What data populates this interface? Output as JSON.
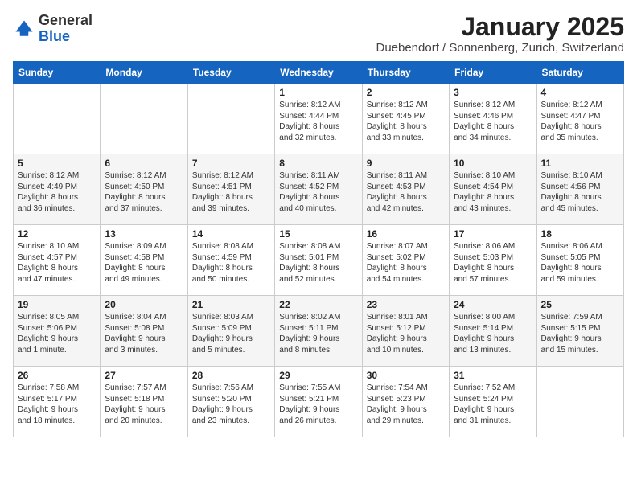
{
  "logo": {
    "general": "General",
    "blue": "Blue"
  },
  "title": "January 2025",
  "subtitle": "Duebendorf / Sonnenberg, Zurich, Switzerland",
  "weekdays": [
    "Sunday",
    "Monday",
    "Tuesday",
    "Wednesday",
    "Thursday",
    "Friday",
    "Saturday"
  ],
  "weeks": [
    [
      {
        "day": "",
        "info": ""
      },
      {
        "day": "",
        "info": ""
      },
      {
        "day": "",
        "info": ""
      },
      {
        "day": "1",
        "info": "Sunrise: 8:12 AM\nSunset: 4:44 PM\nDaylight: 8 hours\nand 32 minutes."
      },
      {
        "day": "2",
        "info": "Sunrise: 8:12 AM\nSunset: 4:45 PM\nDaylight: 8 hours\nand 33 minutes."
      },
      {
        "day": "3",
        "info": "Sunrise: 8:12 AM\nSunset: 4:46 PM\nDaylight: 8 hours\nand 34 minutes."
      },
      {
        "day": "4",
        "info": "Sunrise: 8:12 AM\nSunset: 4:47 PM\nDaylight: 8 hours\nand 35 minutes."
      }
    ],
    [
      {
        "day": "5",
        "info": "Sunrise: 8:12 AM\nSunset: 4:49 PM\nDaylight: 8 hours\nand 36 minutes."
      },
      {
        "day": "6",
        "info": "Sunrise: 8:12 AM\nSunset: 4:50 PM\nDaylight: 8 hours\nand 37 minutes."
      },
      {
        "day": "7",
        "info": "Sunrise: 8:12 AM\nSunset: 4:51 PM\nDaylight: 8 hours\nand 39 minutes."
      },
      {
        "day": "8",
        "info": "Sunrise: 8:11 AM\nSunset: 4:52 PM\nDaylight: 8 hours\nand 40 minutes."
      },
      {
        "day": "9",
        "info": "Sunrise: 8:11 AM\nSunset: 4:53 PM\nDaylight: 8 hours\nand 42 minutes."
      },
      {
        "day": "10",
        "info": "Sunrise: 8:10 AM\nSunset: 4:54 PM\nDaylight: 8 hours\nand 43 minutes."
      },
      {
        "day": "11",
        "info": "Sunrise: 8:10 AM\nSunset: 4:56 PM\nDaylight: 8 hours\nand 45 minutes."
      }
    ],
    [
      {
        "day": "12",
        "info": "Sunrise: 8:10 AM\nSunset: 4:57 PM\nDaylight: 8 hours\nand 47 minutes."
      },
      {
        "day": "13",
        "info": "Sunrise: 8:09 AM\nSunset: 4:58 PM\nDaylight: 8 hours\nand 49 minutes."
      },
      {
        "day": "14",
        "info": "Sunrise: 8:08 AM\nSunset: 4:59 PM\nDaylight: 8 hours\nand 50 minutes."
      },
      {
        "day": "15",
        "info": "Sunrise: 8:08 AM\nSunset: 5:01 PM\nDaylight: 8 hours\nand 52 minutes."
      },
      {
        "day": "16",
        "info": "Sunrise: 8:07 AM\nSunset: 5:02 PM\nDaylight: 8 hours\nand 54 minutes."
      },
      {
        "day": "17",
        "info": "Sunrise: 8:06 AM\nSunset: 5:03 PM\nDaylight: 8 hours\nand 57 minutes."
      },
      {
        "day": "18",
        "info": "Sunrise: 8:06 AM\nSunset: 5:05 PM\nDaylight: 8 hours\nand 59 minutes."
      }
    ],
    [
      {
        "day": "19",
        "info": "Sunrise: 8:05 AM\nSunset: 5:06 PM\nDaylight: 9 hours\nand 1 minute."
      },
      {
        "day": "20",
        "info": "Sunrise: 8:04 AM\nSunset: 5:08 PM\nDaylight: 9 hours\nand 3 minutes."
      },
      {
        "day": "21",
        "info": "Sunrise: 8:03 AM\nSunset: 5:09 PM\nDaylight: 9 hours\nand 5 minutes."
      },
      {
        "day": "22",
        "info": "Sunrise: 8:02 AM\nSunset: 5:11 PM\nDaylight: 9 hours\nand 8 minutes."
      },
      {
        "day": "23",
        "info": "Sunrise: 8:01 AM\nSunset: 5:12 PM\nDaylight: 9 hours\nand 10 minutes."
      },
      {
        "day": "24",
        "info": "Sunrise: 8:00 AM\nSunset: 5:14 PM\nDaylight: 9 hours\nand 13 minutes."
      },
      {
        "day": "25",
        "info": "Sunrise: 7:59 AM\nSunset: 5:15 PM\nDaylight: 9 hours\nand 15 minutes."
      }
    ],
    [
      {
        "day": "26",
        "info": "Sunrise: 7:58 AM\nSunset: 5:17 PM\nDaylight: 9 hours\nand 18 minutes."
      },
      {
        "day": "27",
        "info": "Sunrise: 7:57 AM\nSunset: 5:18 PM\nDaylight: 9 hours\nand 20 minutes."
      },
      {
        "day": "28",
        "info": "Sunrise: 7:56 AM\nSunset: 5:20 PM\nDaylight: 9 hours\nand 23 minutes."
      },
      {
        "day": "29",
        "info": "Sunrise: 7:55 AM\nSunset: 5:21 PM\nDaylight: 9 hours\nand 26 minutes."
      },
      {
        "day": "30",
        "info": "Sunrise: 7:54 AM\nSunset: 5:23 PM\nDaylight: 9 hours\nand 29 minutes."
      },
      {
        "day": "31",
        "info": "Sunrise: 7:52 AM\nSunset: 5:24 PM\nDaylight: 9 hours\nand 31 minutes."
      },
      {
        "day": "",
        "info": ""
      }
    ]
  ]
}
